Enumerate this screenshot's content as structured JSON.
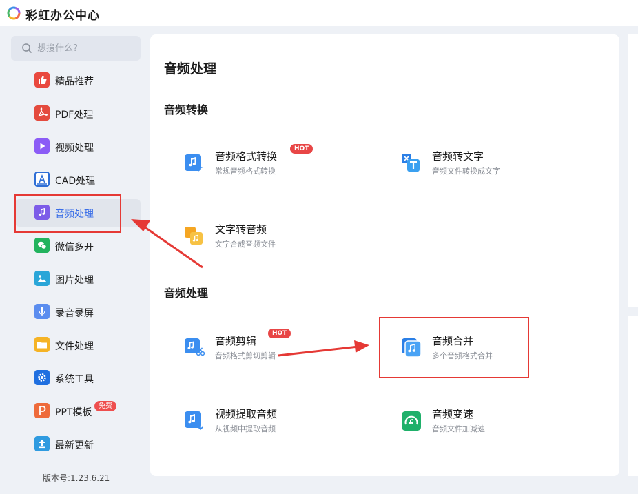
{
  "app": {
    "title": "彩虹办公中心"
  },
  "search": {
    "placeholder": "想搜什么?"
  },
  "sidebar": {
    "items": [
      {
        "label": "精品推荐",
        "icon": "thumbs-up-icon",
        "color": "#e9493f"
      },
      {
        "label": "PDF处理",
        "icon": "pdf-icon",
        "color": "#e44b3e"
      },
      {
        "label": "视频处理",
        "icon": "video-icon",
        "color": "#8b5cf6"
      },
      {
        "label": "CAD处理",
        "icon": "cad-icon",
        "color": "#2f6fd6"
      },
      {
        "label": "音频处理",
        "icon": "music-note-icon",
        "color": "#7c5ce8",
        "active": true
      },
      {
        "label": "微信多开",
        "icon": "wechat-icon",
        "color": "#22b35e"
      },
      {
        "label": "图片处理",
        "icon": "image-icon",
        "color": "#2aa6d8"
      },
      {
        "label": "录音录屏",
        "icon": "microphone-icon",
        "color": "#5b8def"
      },
      {
        "label": "文件处理",
        "icon": "folder-icon",
        "color": "#f5b325"
      },
      {
        "label": "系统工具",
        "icon": "gear-icon",
        "color": "#1f6fe0"
      },
      {
        "label": "PPT模板",
        "icon": "ppt-icon",
        "color": "#ee6b3b",
        "badge": "免费"
      },
      {
        "label": "最新更新",
        "icon": "upload-icon",
        "color": "#2f9be0"
      }
    ],
    "version": "版本号:1.23.6.21"
  },
  "main": {
    "title": "音频处理",
    "sections": [
      {
        "title": "音频转换",
        "cards": [
          {
            "name": "音频格式转换",
            "desc": "常规音频格式转换",
            "badge": "HOT",
            "icon": "audio-convert-icon"
          },
          {
            "name": "音频转文字",
            "desc": "音频文件转换成文字",
            "icon": "audio-to-text-icon"
          },
          {
            "name": "文字转音频",
            "desc": "文字合成音频文件",
            "icon": "text-to-audio-icon"
          }
        ]
      },
      {
        "title": "音频处理",
        "cards": [
          {
            "name": "音频剪辑",
            "desc": "音频格式剪切剪辑",
            "badge": "HOT",
            "icon": "audio-cut-icon"
          },
          {
            "name": "音频合并",
            "desc": "多个音频格式合并",
            "icon": "audio-merge-icon"
          },
          {
            "name": "视频提取音频",
            "desc": "从视频中提取音频",
            "icon": "video-extract-audio-icon"
          },
          {
            "name": "音频变速",
            "desc": "音频文件加减速",
            "icon": "audio-speed-icon"
          }
        ]
      }
    ]
  },
  "colors": {
    "accent": "#3a6ee8",
    "annotation": "#e53935",
    "hot": "#e84646"
  }
}
